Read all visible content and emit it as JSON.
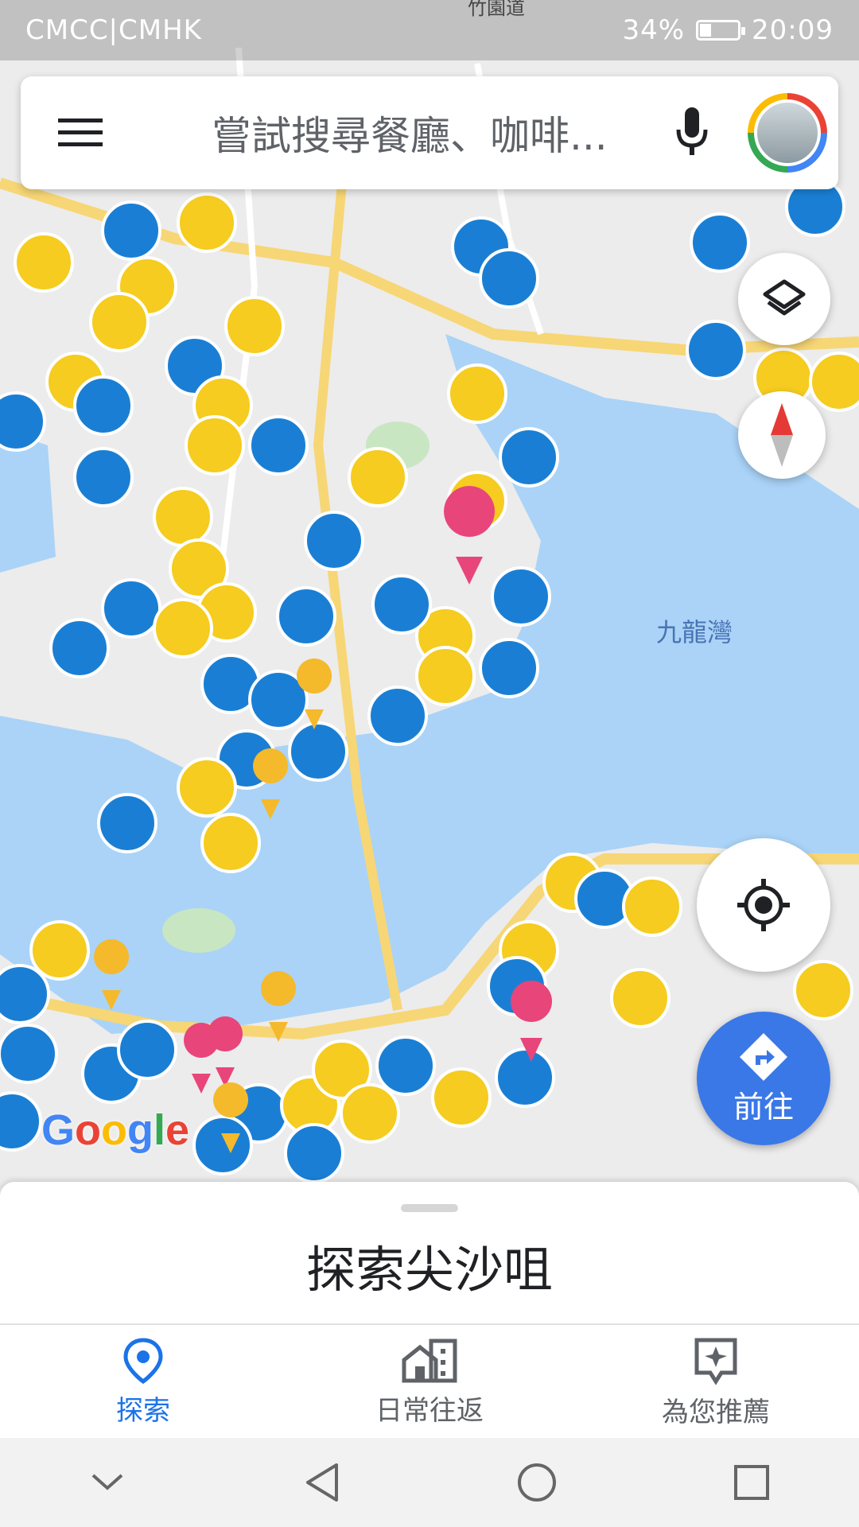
{
  "status_bar": {
    "carrier": "CMCC|CMHK",
    "battery": "34%",
    "time": "20:09"
  },
  "search": {
    "placeholder": "嘗試搜尋餐廳、咖啡..."
  },
  "map": {
    "street_label": "竹園道",
    "bay_label": "九龍灣",
    "attribution": "Google",
    "go_label": "前往"
  },
  "sheet": {
    "title": "探索尖沙咀"
  },
  "bottom_nav": {
    "items": [
      {
        "label": "探索",
        "icon": "location-pin-icon",
        "active": true
      },
      {
        "label": "日常往返",
        "icon": "commute-icon",
        "active": false
      },
      {
        "label": "為您推薦",
        "icon": "for-you-icon",
        "active": false
      }
    ]
  },
  "colors": {
    "water": "#aad3f7",
    "land": "#ececec",
    "road": "#f7d675",
    "poi_blue": "#1a7fd4",
    "poi_yellow": "#f5cc1f",
    "poi_pink": "#e8457a",
    "accent": "#1a73e8"
  }
}
